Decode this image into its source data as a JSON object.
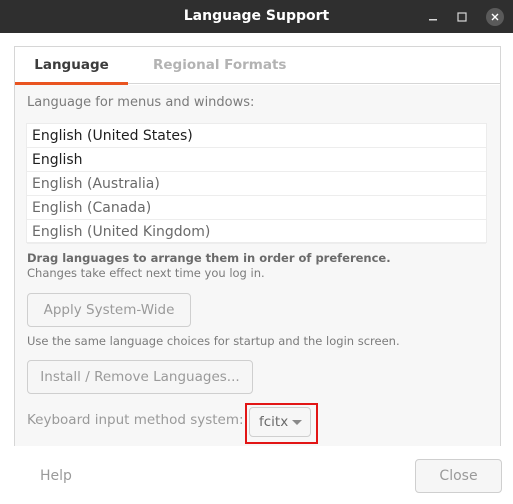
{
  "window": {
    "title": "Language Support",
    "controls": {
      "minimize_icon": "minimize-icon",
      "maximize_icon": "maximize-icon",
      "close_icon": "close-icon"
    }
  },
  "tabs": [
    {
      "label": "Language",
      "active": true
    },
    {
      "label": "Regional Formats",
      "active": false
    }
  ],
  "language_tab": {
    "list_label": "Language for menus and windows:",
    "languages": [
      "English (United States)",
      "English",
      "English (Australia)",
      "English (Canada)",
      "English (United Kingdom)"
    ],
    "drag_hint": "Drag languages to arrange them in order of preference.",
    "change_hint": "Changes take effect next time you log in.",
    "apply_button": "Apply System-Wide",
    "apply_note": "Use the same language choices for startup and the login screen.",
    "install_button": "Install / Remove Languages...",
    "keyboard_label": "Keyboard input method system:",
    "keyboard_value": "fcitx"
  },
  "footer": {
    "help_label": "Help",
    "close_label": "Close"
  },
  "colors": {
    "accent": "#e95420",
    "highlight": "#e21515",
    "titlebar": "#2f2f2f"
  }
}
